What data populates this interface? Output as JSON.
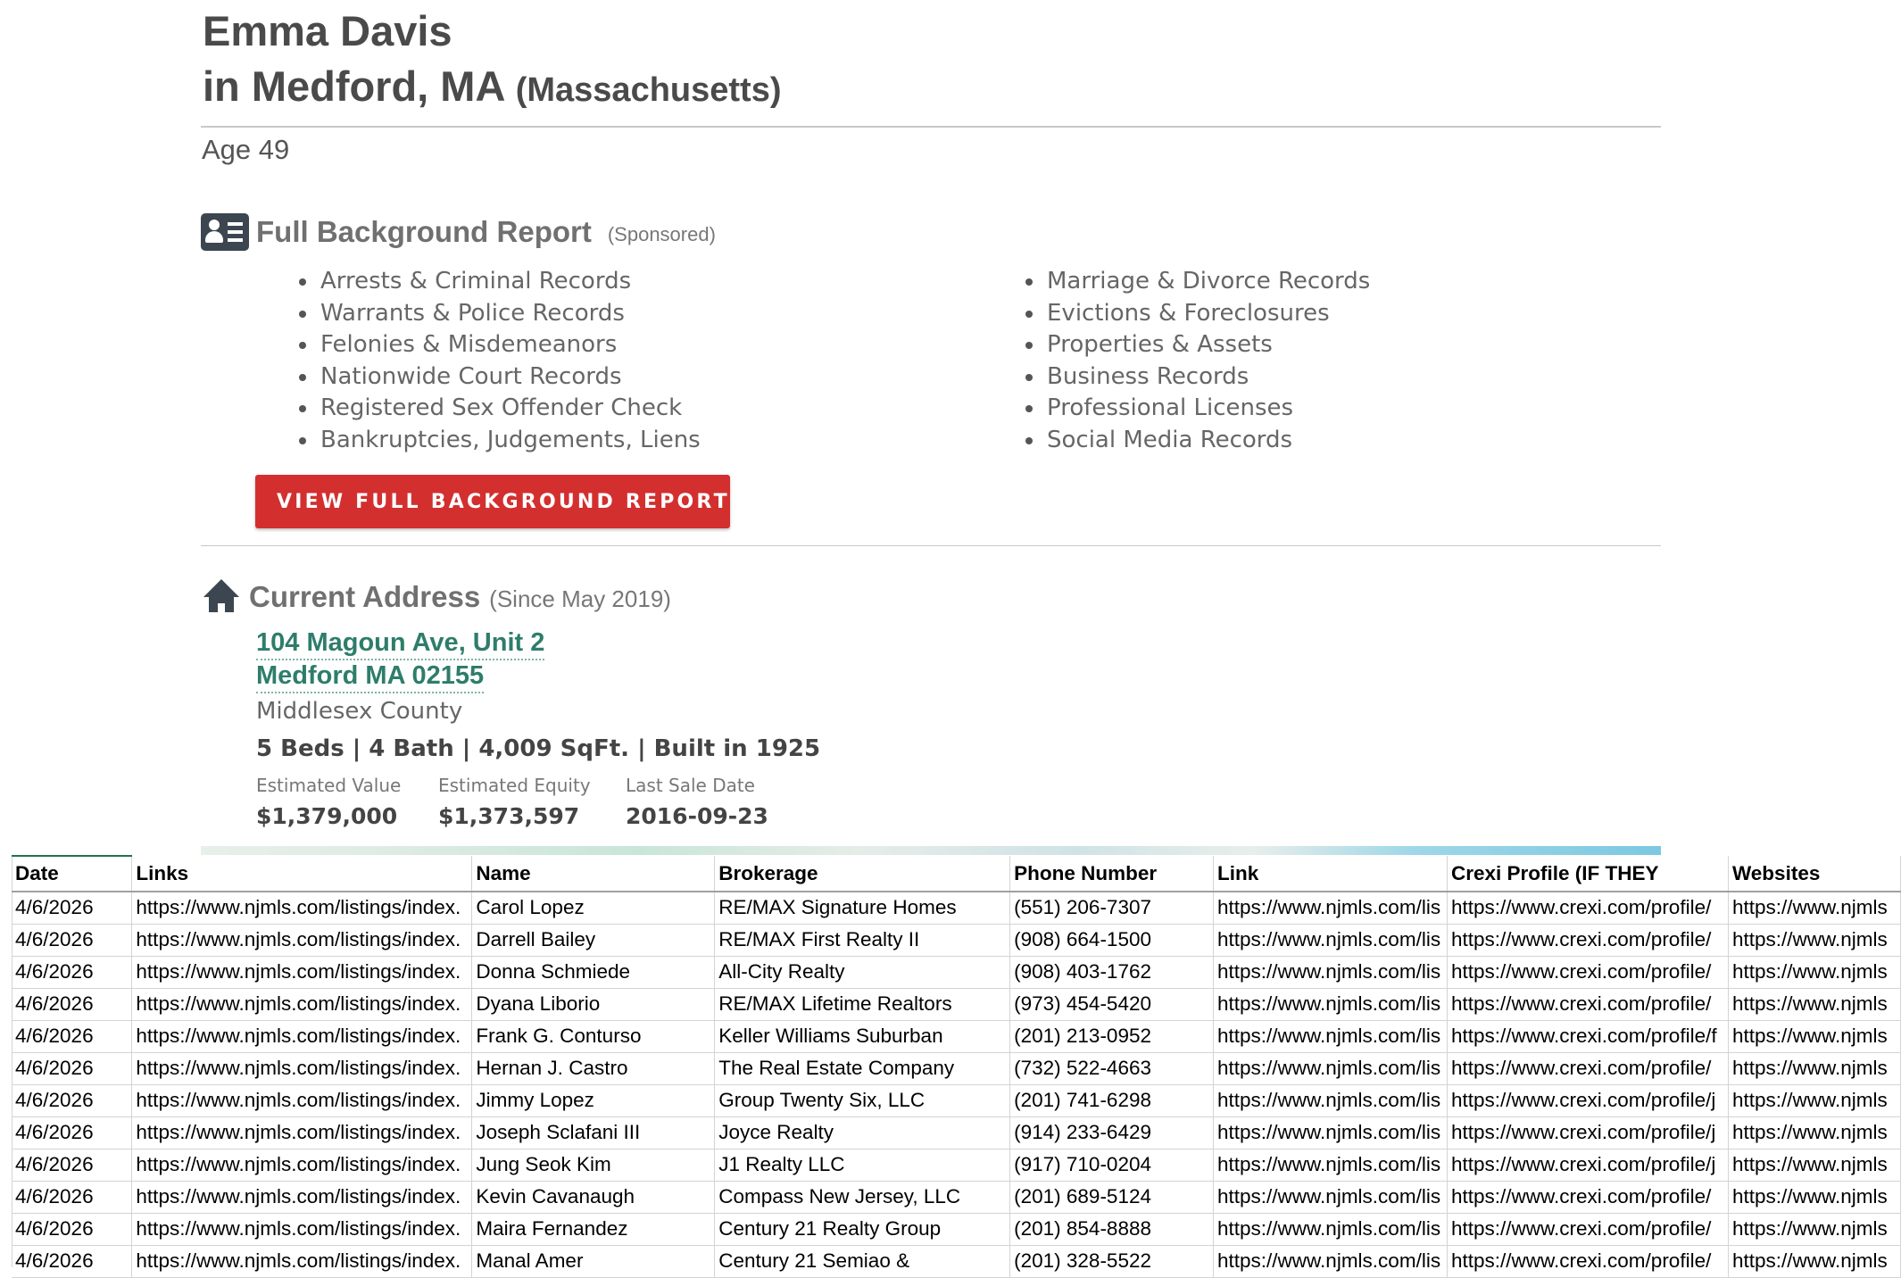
{
  "profile": {
    "name": "Emma Davis",
    "location_prefix": "in Medford, MA",
    "state_full": "(Massachusetts)",
    "age": "Age 49"
  },
  "background_report": {
    "icon": "id-card-icon",
    "title": "Full Background Report",
    "sponsored": "(Sponsored)",
    "left_items": [
      "Arrests & Criminal Records",
      "Warrants & Police Records",
      "Felonies & Misdemeanors",
      "Nationwide Court Records",
      "Registered Sex Offender Check",
      "Bankruptcies, Judgements, Liens"
    ],
    "right_items": [
      "Marriage & Divorce Records",
      "Evictions & Foreclosures",
      "Properties & Assets",
      "Business Records",
      "Professional Licenses",
      "Social Media Records"
    ],
    "cta_label": "VIEW FULL BACKGROUND REPORT",
    "cta_icon": "double-chevron-right-icon",
    "accent_color": "#d32f2f"
  },
  "current_address": {
    "icon": "house-icon",
    "title": "Current Address",
    "since": "(Since May 2019)",
    "street": "104 Magoun Ave, Unit 2",
    "city_line": "Medford MA 02155",
    "county": "Middlesex County",
    "specs": "5 Beds | 4 Bath | 4,009 SqFt. | Built in 1925",
    "estimated_value_label": "Estimated Value",
    "estimated_value": "$1,379,000",
    "estimated_equity_label": "Estimated Equity",
    "estimated_equity": "$1,373,597",
    "last_sale_label": "Last Sale Date",
    "last_sale": "2016-09-23",
    "link_color": "#2e7d6b"
  },
  "spreadsheet": {
    "headers": [
      "Date",
      "Links",
      "Name",
      "Brokerage",
      "Phone Number",
      "Link",
      "Crexi Profile (IF THEY",
      "Websites"
    ],
    "rows": [
      [
        "4/6/2026",
        "https://www.njmls.com/listings/index.",
        "Carol Lopez",
        "RE/MAX Signature Homes",
        "(551) 206-7307",
        "https://www.njmls.com/lis",
        "https://www.crexi.com/profile/",
        "https://www.njmls"
      ],
      [
        "4/6/2026",
        "https://www.njmls.com/listings/index.",
        "Darrell Bailey",
        "RE/MAX First Realty II",
        "(908) 664-1500",
        "https://www.njmls.com/lis",
        "https://www.crexi.com/profile/",
        "https://www.njmls"
      ],
      [
        "4/6/2026",
        "https://www.njmls.com/listings/index.",
        "Donna Schmiede",
        "All-City Realty",
        "(908) 403-1762",
        "https://www.njmls.com/lis",
        "https://www.crexi.com/profile/",
        "https://www.njmls"
      ],
      [
        "4/6/2026",
        "https://www.njmls.com/listings/index.",
        "Dyana Liborio",
        "RE/MAX Lifetime Realtors",
        "(973) 454-5420",
        "https://www.njmls.com/lis",
        "https://www.crexi.com/profile/",
        "https://www.njmls"
      ],
      [
        "4/6/2026",
        "https://www.njmls.com/listings/index.",
        "Frank G. Conturso",
        "Keller Williams Suburban",
        "(201) 213-0952",
        "https://www.njmls.com/lis",
        "https://www.crexi.com/profile/f",
        "https://www.njmls"
      ],
      [
        "4/6/2026",
        "https://www.njmls.com/listings/index.",
        "Hernan J. Castro",
        "The Real Estate Company",
        "(732) 522-4663",
        "https://www.njmls.com/lis",
        "https://www.crexi.com/profile/",
        "https://www.njmls"
      ],
      [
        "4/6/2026",
        "https://www.njmls.com/listings/index.",
        "Jimmy Lopez",
        "Group Twenty Six, LLC",
        "(201) 741-6298",
        "https://www.njmls.com/lis",
        "https://www.crexi.com/profile/j",
        "https://www.njmls"
      ],
      [
        "4/6/2026",
        "https://www.njmls.com/listings/index.",
        "Joseph Sclafani III",
        "Joyce Realty",
        "(914) 233-6429",
        "https://www.njmls.com/lis",
        "https://www.crexi.com/profile/j",
        "https://www.njmls"
      ],
      [
        "4/6/2026",
        "https://www.njmls.com/listings/index.",
        "Jung Seok Kim",
        "J1 Realty LLC",
        "(917) 710-0204",
        "https://www.njmls.com/lis",
        "https://www.crexi.com/profile/j",
        "https://www.njmls"
      ],
      [
        "4/6/2026",
        "https://www.njmls.com/listings/index.",
        "Kevin Cavanaugh",
        "Compass New Jersey, LLC",
        "(201) 689-5124",
        "https://www.njmls.com/lis",
        "https://www.crexi.com/profile/",
        "https://www.njmls"
      ],
      [
        "4/6/2026",
        "https://www.njmls.com/listings/index.",
        "Maira Fernandez",
        "Century 21 Realty Group",
        "(201) 854-8888",
        "https://www.njmls.com/lis",
        "https://www.crexi.com/profile/",
        "https://www.njmls"
      ],
      [
        "4/6/2026",
        "https://www.njmls.com/listings/index.",
        "Manal Amer",
        "Century 21 Semiao &",
        "(201) 328-5522",
        "https://www.njmls.com/lis",
        "https://www.crexi.com/profile/",
        "https://www.njmls"
      ]
    ]
  }
}
